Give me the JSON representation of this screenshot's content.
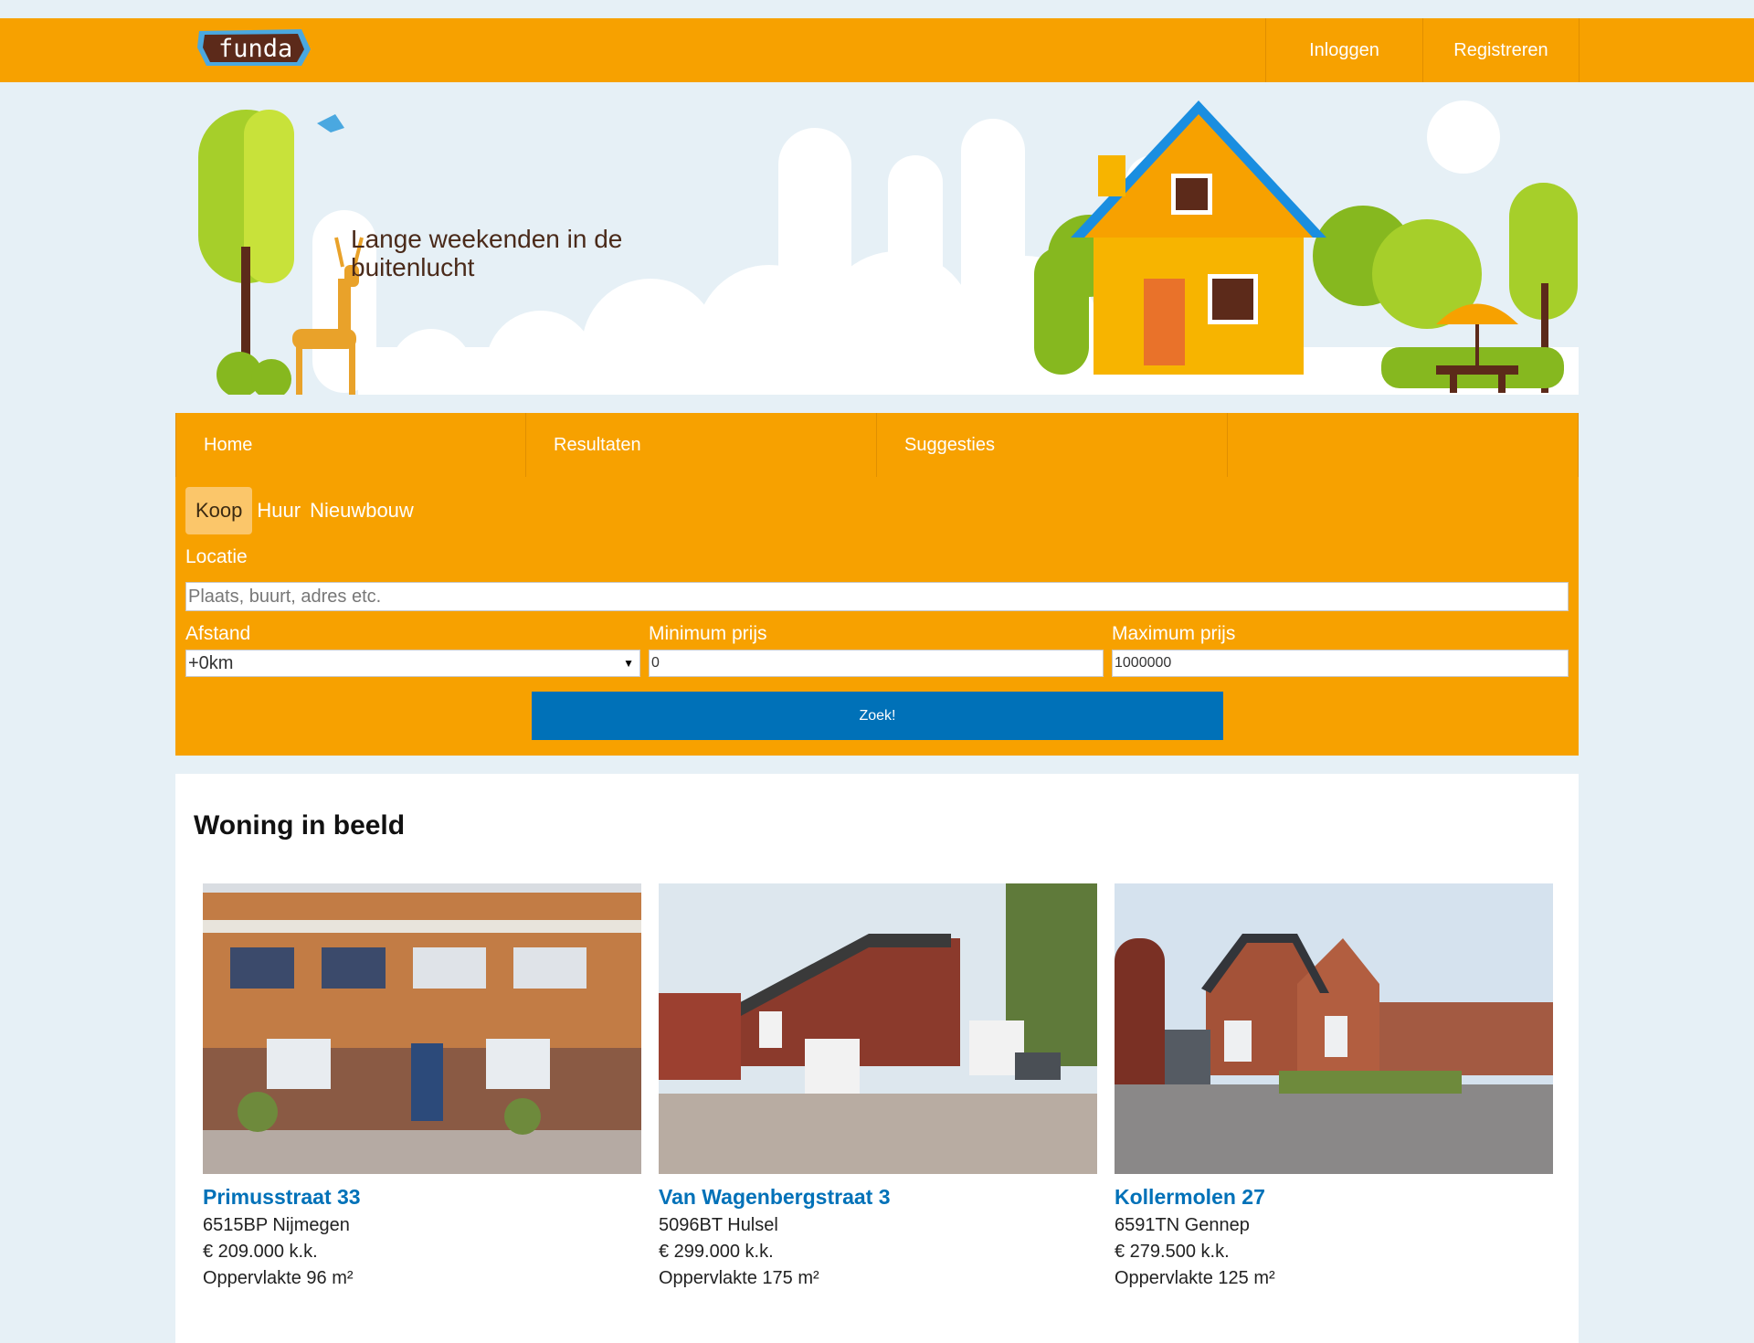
{
  "header": {
    "logo_text": "funda",
    "login_label": "Inloggen",
    "register_label": "Registreren"
  },
  "hero": {
    "tagline": "Lange weekenden in de buitenlucht"
  },
  "nav": {
    "tabs": [
      {
        "label": "Home"
      },
      {
        "label": "Resultaten"
      },
      {
        "label": "Suggesties"
      }
    ]
  },
  "search": {
    "types": [
      {
        "label": "Koop",
        "active": true
      },
      {
        "label": "Huur",
        "active": false
      },
      {
        "label": "Nieuwbouw",
        "active": false
      }
    ],
    "location_label": "Locatie",
    "location_placeholder": "Plaats, buurt, adres etc.",
    "distance_label": "Afstand",
    "distance_value": "+0km",
    "min_price_label": "Minimum prijs",
    "min_price_value": "0",
    "max_price_label": "Maximum prijs",
    "max_price_value": "1000000",
    "submit_label": "Zoek!"
  },
  "featured": {
    "title": "Woning in beeld",
    "listings": [
      {
        "street": "Primusstraat 33",
        "postal_city": "6515BP Nijmegen",
        "price": "€ 209.000 k.k.",
        "area": "Oppervlakte 96 m²"
      },
      {
        "street": "Van Wagenbergstraat 3",
        "postal_city": "5096BT Hulsel",
        "price": "€ 299.000 k.k.",
        "area": "Oppervlakte 175 m²"
      },
      {
        "street": "Kollermolen 27",
        "postal_city": "6591TN Gennep",
        "price": "€ 279.500 k.k.",
        "area": "Oppervlakte 125 m²"
      }
    ]
  },
  "colors": {
    "brand_orange": "#f7a100",
    "link_blue": "#0071b8",
    "page_bg": "#e6f0f6"
  }
}
